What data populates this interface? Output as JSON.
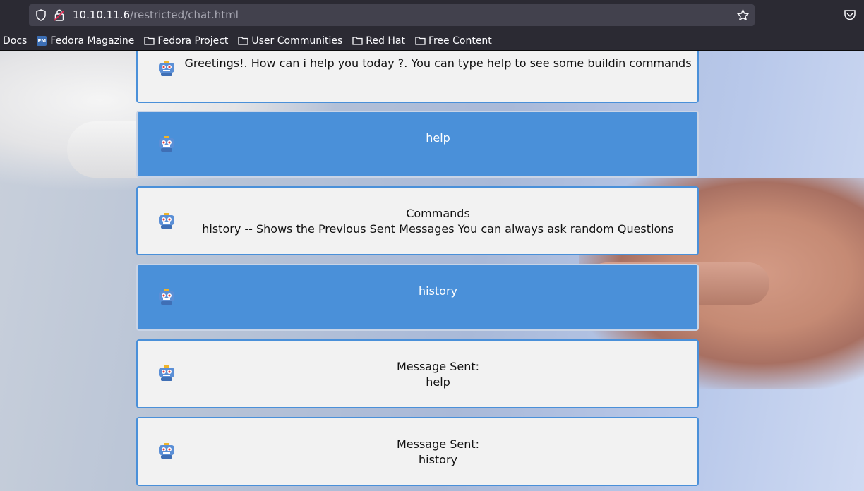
{
  "browser": {
    "url_host": "10.10.11.6",
    "url_path": "/restricted/chat.html",
    "bookmarks": [
      {
        "label": "Docs",
        "icon": "none"
      },
      {
        "label": "Fedora Magazine",
        "icon": "fedora-magazine-icon",
        "icon_text": "FM"
      },
      {
        "label": "Fedora Project",
        "icon": "folder-icon"
      },
      {
        "label": "User Communities",
        "icon": "folder-icon"
      },
      {
        "label": "Red Hat",
        "icon": "folder-icon"
      },
      {
        "label": "Free Content",
        "icon": "folder-icon"
      }
    ]
  },
  "chat": {
    "messages": [
      {
        "role": "bot",
        "lines": [
          "Greetings!. How can i help you today ?. You can type help to see some buildin commands"
        ]
      },
      {
        "role": "user",
        "lines": [
          "help"
        ]
      },
      {
        "role": "bot",
        "lines": [
          "Commands",
          "history -- Shows the Previous Sent Messages You can always ask random Questions"
        ]
      },
      {
        "role": "user",
        "lines": [
          "history"
        ]
      },
      {
        "role": "bot",
        "lines": [
          "Message Sent:",
          "help"
        ]
      },
      {
        "role": "bot",
        "lines": [
          "Message Sent:",
          "history"
        ]
      }
    ]
  },
  "colors": {
    "user_bubble": "#4a90d9",
    "bot_bubble": "#f2f2f2",
    "bubble_border": "#4a90d9"
  }
}
